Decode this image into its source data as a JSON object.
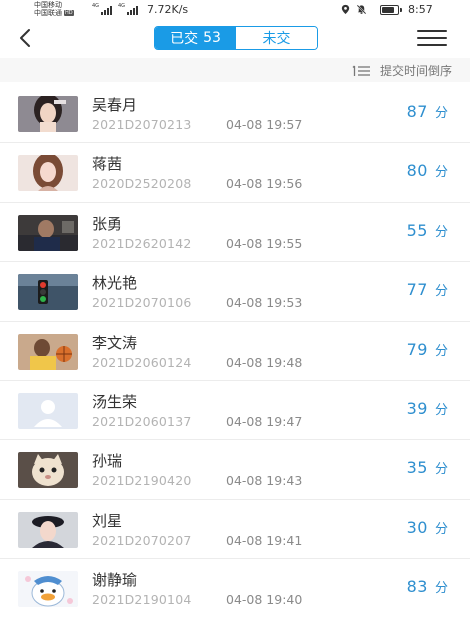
{
  "status_bar": {
    "carrier_1": "中国移动",
    "carrier_2": "中国联通",
    "carrier_2_badge": "HD",
    "signal_1_label": "4G",
    "signal_2_label": "4G",
    "net_speed": "7.72K/s",
    "time": "8:57",
    "icons": [
      "location-icon",
      "mute-icon",
      "wifi-off-icon",
      "battery-icon"
    ]
  },
  "header": {
    "back_icon": "chevron-left-icon",
    "tabs": [
      {
        "label": "已交",
        "count": "53",
        "active": true
      },
      {
        "label": "未交",
        "count": "",
        "active": false
      }
    ],
    "menu_icon": "hamburger-menu-icon"
  },
  "sort": {
    "label": "提交时间倒序",
    "icon": "sort-list-icon"
  },
  "colors": {
    "accent": "#1a9be6",
    "score": "#2f8fcf",
    "id_text": "#b3b3b3"
  },
  "submissions": [
    {
      "name": "吴春月",
      "student_id": "2021D2070213",
      "time": "04-08 19:57",
      "score": "87",
      "unit": "分",
      "avatar": "avatar-photo-girl-dark-hair"
    },
    {
      "name": "蒋茜",
      "student_id": "2020D2520208",
      "time": "04-08 19:56",
      "score": "80",
      "unit": "分",
      "avatar": "avatar-photo-girl-brown-hair"
    },
    {
      "name": "张勇",
      "student_id": "2021D2620142",
      "time": "04-08 19:55",
      "score": "55",
      "unit": "分",
      "avatar": "avatar-photo-man-dark"
    },
    {
      "name": "林光艳",
      "student_id": "2021D2070106",
      "time": "04-08 19:53",
      "score": "77",
      "unit": "分",
      "avatar": "avatar-photo-traffic-light"
    },
    {
      "name": "李文涛",
      "student_id": "2021D2060124",
      "time": "04-08 19:48",
      "score": "79",
      "unit": "分",
      "avatar": "avatar-photo-basketball-player"
    },
    {
      "name": "汤生荣",
      "student_id": "2021D2060137",
      "time": "04-08 19:47",
      "score": "39",
      "unit": "分",
      "avatar": "avatar-default-placeholder"
    },
    {
      "name": "孙瑞",
      "student_id": "2021D2190420",
      "time": "04-08 19:43",
      "score": "35",
      "unit": "分",
      "avatar": "avatar-photo-cat"
    },
    {
      "name": "刘星",
      "student_id": "2021D2070207",
      "time": "04-08 19:41",
      "score": "30",
      "unit": "分",
      "avatar": "avatar-photo-girl-hat"
    },
    {
      "name": "谢静瑜",
      "student_id": "2021D2190104",
      "time": "04-08 19:40",
      "score": "83",
      "unit": "分",
      "avatar": "avatar-cartoon-duck"
    }
  ]
}
